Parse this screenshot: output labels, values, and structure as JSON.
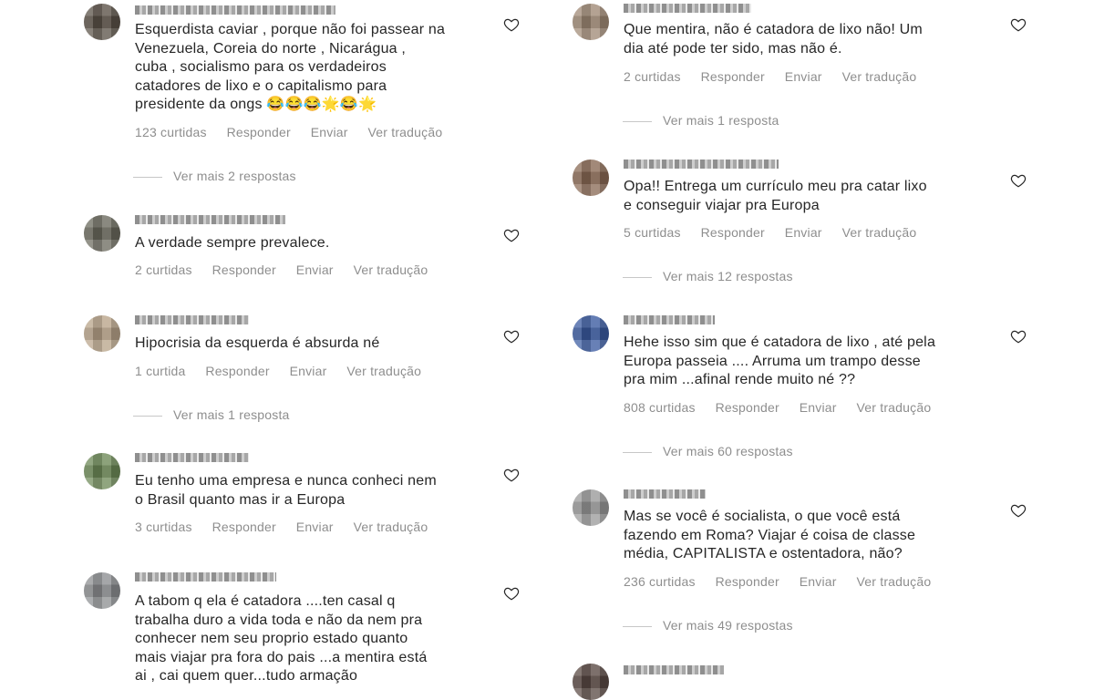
{
  "left": [
    {
      "avatar_color": "#5b5248",
      "text": "Esquerdista caviar , porque não foi passear na\nVenezuela, Coreia do norte , Nicarágua ,\ncuba , socialismo para os verdadeiros\ncatadores de lixo e o capitalismo para\npresidente da ongs 😂😂😂🌟😂🌟",
      "likes": "123 curtidas",
      "reply": "Responder",
      "send": "Enviar",
      "translate": "Ver tradução",
      "more": "Ver mais 2 respostas"
    },
    {
      "avatar_color": "#6b6a5e",
      "text": "A verdade sempre prevalece.",
      "likes": "2 curtidas",
      "reply": "Responder",
      "send": "Enviar",
      "translate": "Ver tradução"
    },
    {
      "avatar_color": "#b9a48a",
      "text": "Hipocrisia da esquerda é absurda né",
      "likes": "1 curtida",
      "reply": "Responder",
      "send": "Enviar",
      "translate": "Ver tradução",
      "more": "Ver mais 1 resposta"
    },
    {
      "avatar_color": "#6e8a58",
      "text": "Eu tenho uma empresa e nunca conheci nem\no Brasil quanto mas ir a Europa",
      "likes": "3 curtidas",
      "reply": "Responder",
      "send": "Enviar",
      "translate": "Ver tradução"
    },
    {
      "avatar_color": "#8d8f92",
      "text": "A tabom q ela é catadora ....ten casal q\ntrabalha duro a vida toda e não da nem pra\nconhecer nem seu proprio estado quanto\nmais viajar pra fora do pais ...a mentira está\nai , cai quem quer...tudo armação"
    }
  ],
  "right": [
    {
      "avatar_color": "#a08a76",
      "text": "Que mentira, não é catadora de lixo não! Um\ndia até pode ter sido, mas não é.",
      "likes": "2 curtidas",
      "reply": "Responder",
      "send": "Enviar",
      "translate": "Ver tradução",
      "more": "Ver mais 1 resposta"
    },
    {
      "avatar_color": "#8a6a55",
      "text": "Opa!! Entrega um currículo meu pra catar lixo\ne conseguir viajar pra Europa",
      "likes": "5 curtidas",
      "reply": "Responder",
      "send": "Enviar",
      "translate": "Ver tradução",
      "more": "Ver mais 12 respostas"
    },
    {
      "avatar_color": "#3a5aa0",
      "text": "Hehe isso sim que é catadora de lixo , até pela\nEuropa passeia .... Arruma um trampo desse\npra mim ...afinal rende muito né ??",
      "likes": "808 curtidas",
      "reply": "Responder",
      "send": "Enviar",
      "translate": "Ver tradução",
      "more": "Ver mais 60 respostas"
    },
    {
      "avatar_color": "#9a9a9a",
      "text": "Mas se você é socialista, o que você está\nfazendo em Roma? Viajar é coisa de classe\nmédia, CAPITALISTA e ostentadora, não?",
      "likes": "236 curtidas",
      "reply": "Responder",
      "send": "Enviar",
      "translate": "Ver tradução",
      "more": "Ver mais 49 respostas"
    },
    {
      "avatar_color": "#5a4a44"
    }
  ]
}
